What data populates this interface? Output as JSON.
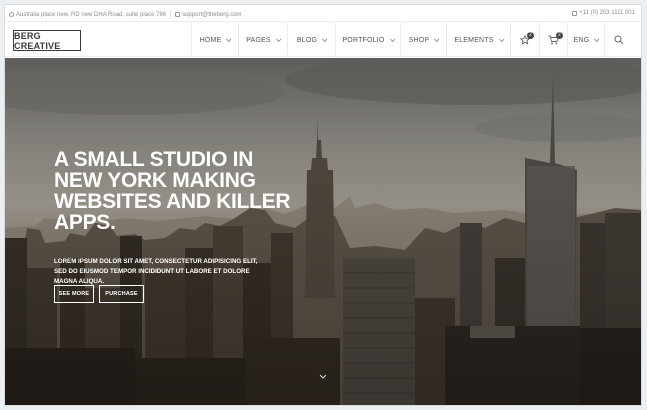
{
  "topbar": {
    "address": "Australia place new, RD new DHA Road, suite place 786",
    "email": "support@theberg.com",
    "phone": "+11 (0) 203 1111 001"
  },
  "header": {
    "logo_text": "BERG CREATIVE",
    "nav": [
      {
        "label": "HOME"
      },
      {
        "label": "PAGES"
      },
      {
        "label": "BLOG"
      },
      {
        "label": "PORTFOLIO"
      },
      {
        "label": "SHOP"
      },
      {
        "label": "ELEMENTS"
      }
    ],
    "wishlist_count": "2",
    "cart_count": "2",
    "language": "ENG"
  },
  "hero": {
    "title": "A SMALL STUDIO IN NEW YORK MAKING WEBSITES AND KILLER APPS.",
    "subtitle": "LOREM IPSUM DOLOR SIT AMET, CONSECTETUR ADIPISICING ELIT, SED DO EIUSMOD TEMPOR INCIDIDUNT UT LABORE ET DOLORE MAGNA ALIQUA.",
    "button_primary": "SEE MORE",
    "button_secondary": "PURCHASE"
  },
  "icons": {
    "address": "location-icon",
    "email": "mail-icon",
    "phone": "phone-icon",
    "wishlist": "star-icon",
    "cart": "cart-icon",
    "search": "search-icon"
  }
}
